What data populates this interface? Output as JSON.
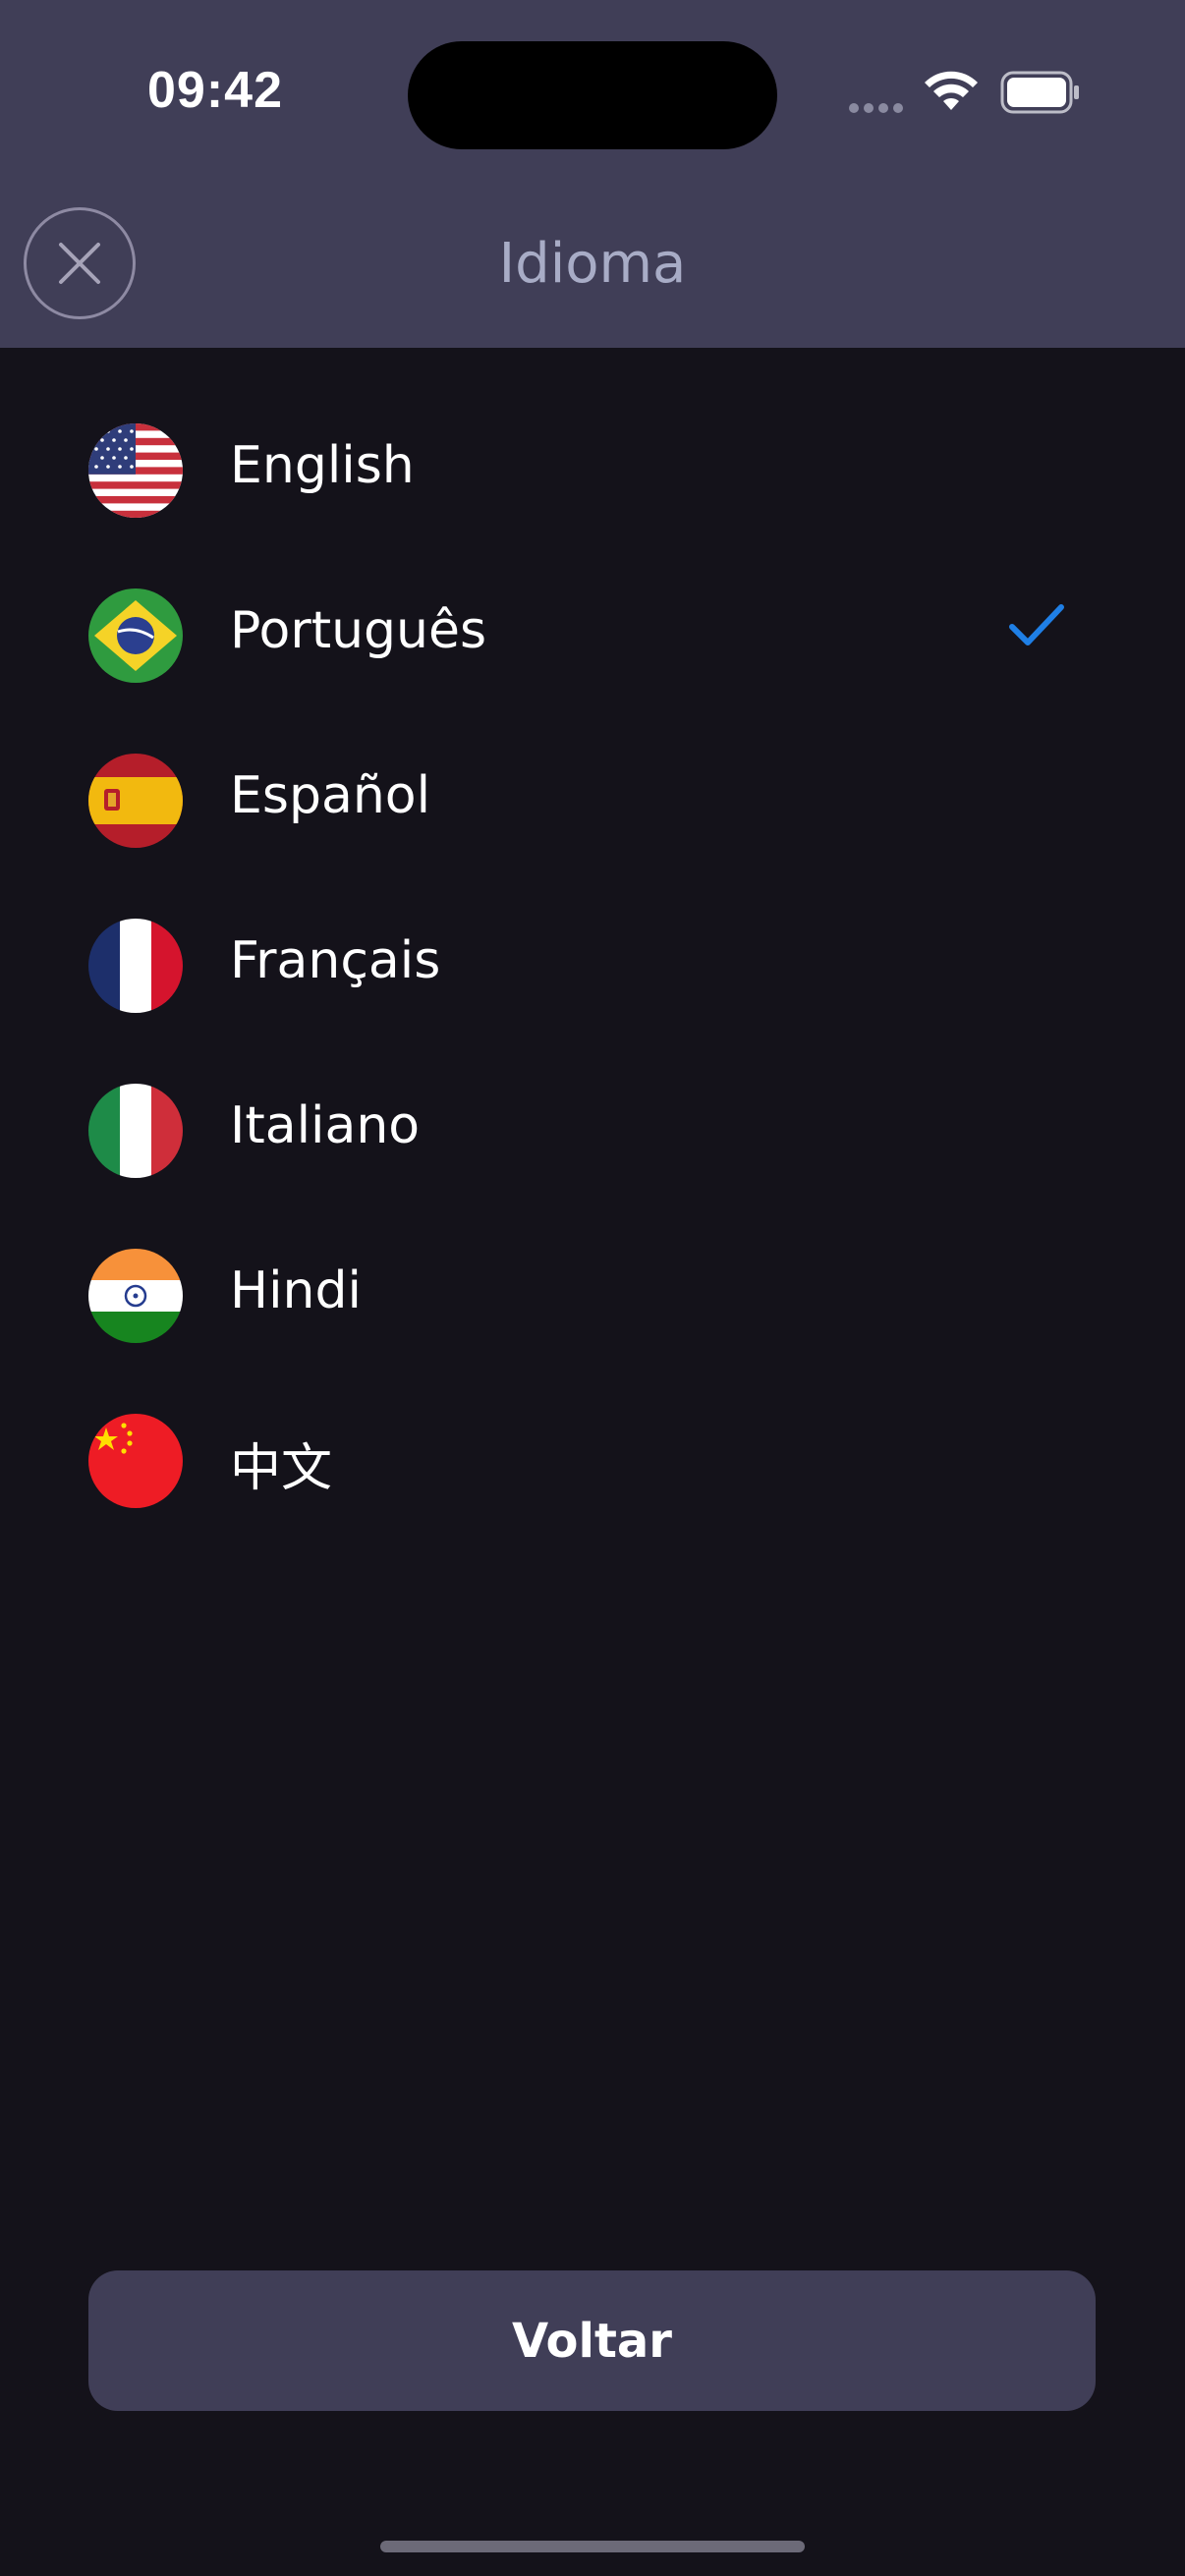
{
  "status_bar": {
    "time": "09:42"
  },
  "header": {
    "title": "Idioma"
  },
  "languages": [
    {
      "label": "English",
      "flag": "us-flag-icon",
      "selected": false
    },
    {
      "label": "Português",
      "flag": "brazil-flag-icon",
      "selected": true
    },
    {
      "label": "Español",
      "flag": "spain-flag-icon",
      "selected": false
    },
    {
      "label": "Français",
      "flag": "france-flag-icon",
      "selected": false
    },
    {
      "label": "Italiano",
      "flag": "italy-flag-icon",
      "selected": false
    },
    {
      "label": "Hindi",
      "flag": "india-flag-icon",
      "selected": false
    },
    {
      "label": "中文",
      "flag": "china-flag-icon",
      "selected": false
    }
  ],
  "footer": {
    "back_label": "Voltar"
  },
  "colors": {
    "header_bg": "#403e57",
    "page_bg": "#14121a",
    "accent_check": "#1f7fe6",
    "title": "#a8acc6"
  }
}
